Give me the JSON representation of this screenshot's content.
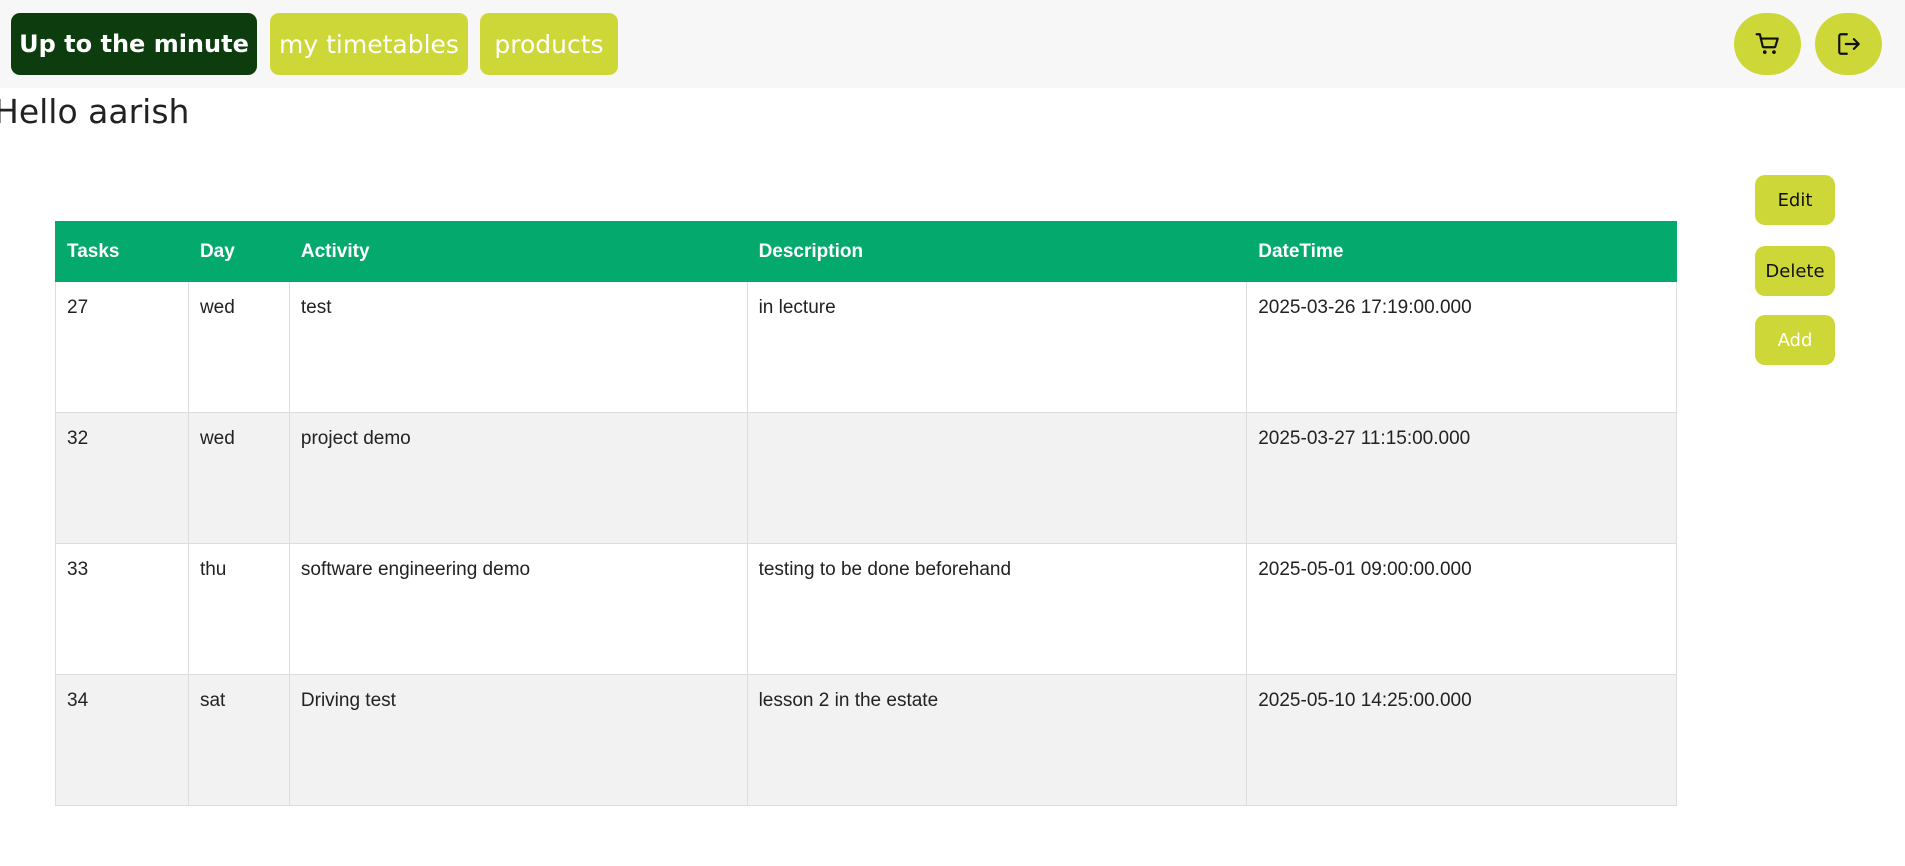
{
  "nav": {
    "brand_label": "Up to the minute",
    "timetables_label": "my timetables",
    "products_label": "products",
    "cart_icon": "cart-icon",
    "logout_icon": "logout-icon"
  },
  "greeting": "Hello aarish",
  "actions": {
    "edit_label": "Edit",
    "delete_label": "Delete",
    "add_label": "Add"
  },
  "table": {
    "headers": [
      "Tasks",
      "Day",
      "Activity",
      "Description",
      "DateTime"
    ],
    "rows": [
      {
        "task": "27",
        "day": "wed",
        "activity": "test",
        "description": "in lecture",
        "datetime": "2025-03-26 17:19:00.000"
      },
      {
        "task": "32",
        "day": "wed",
        "activity": "project demo",
        "description": "",
        "datetime": "2025-03-27 11:15:00.000"
      },
      {
        "task": "33",
        "day": "thu",
        "activity": "software engineering demo",
        "description": "testing to be done beforehand",
        "datetime": "2025-05-01 09:00:00.000"
      },
      {
        "task": "34",
        "day": "sat",
        "activity": "Driving test",
        "description": "lesson 2 in the estate",
        "datetime": "2025-05-10 14:25:00.000"
      }
    ]
  },
  "colors": {
    "brand_dark_green": "#0d3d0f",
    "accent_lime": "#cdd838",
    "table_header_green": "#04aa6d",
    "row_stripe": "#f2f2f2"
  }
}
